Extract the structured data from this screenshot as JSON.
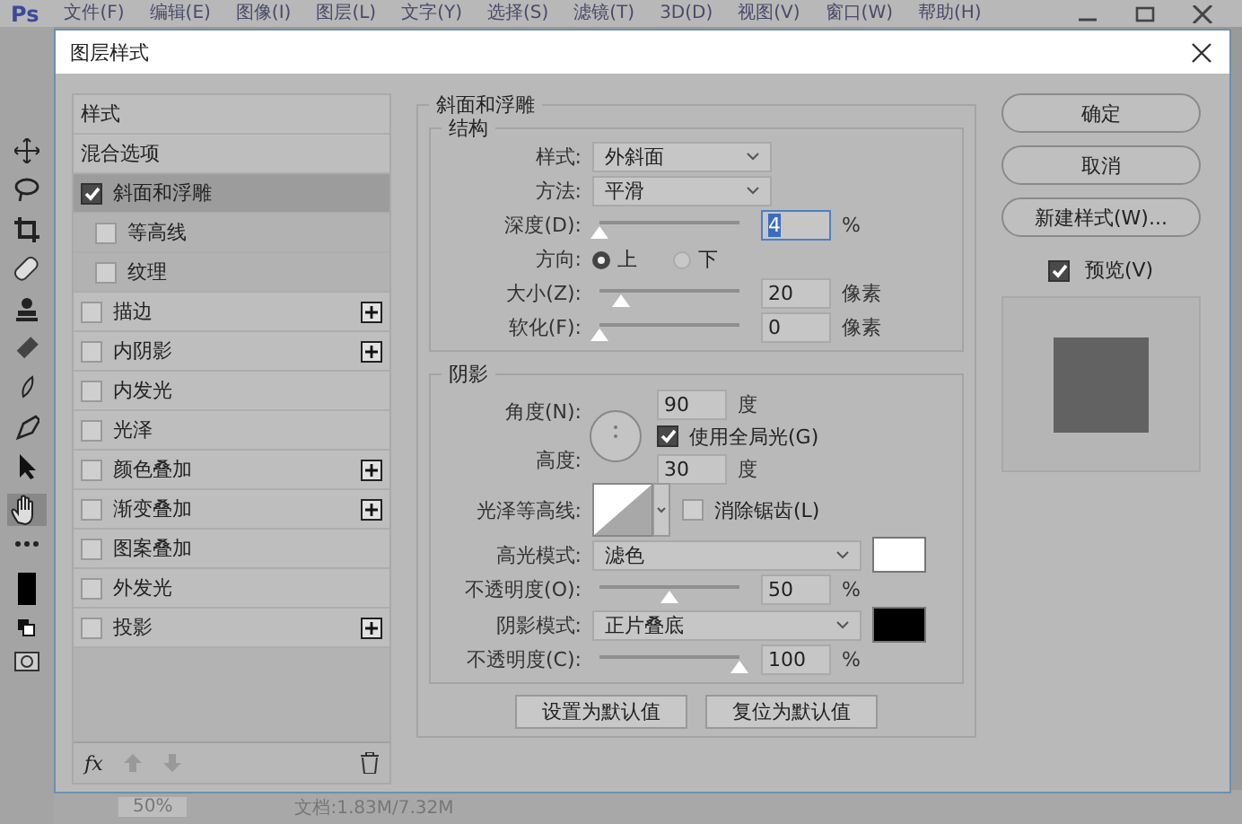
{
  "app": {
    "logo": "Ps",
    "menu": [
      "文件(F)",
      "编辑(E)",
      "图像(I)",
      "图层(L)",
      "文字(Y)",
      "选择(S)",
      "滤镜(T)",
      "3D(D)",
      "视图(V)",
      "窗口(W)",
      "帮助(H)"
    ]
  },
  "status_bar": {
    "zoom": "50%",
    "document": "文档:1.83M/7.32M"
  },
  "dialog": {
    "title": "图层样式",
    "styles_list": [
      {
        "kind": "header",
        "label": "样式",
        "selected": false
      },
      {
        "kind": "header",
        "label": "混合选项",
        "selected": false
      },
      {
        "kind": "effect",
        "label": "斜面和浮雕",
        "checked": true,
        "selected": true,
        "plus": false,
        "children": [
          {
            "label": "等高线",
            "checked": false,
            "selected": false
          },
          {
            "label": "纹理",
            "checked": false,
            "selected": false
          }
        ]
      },
      {
        "kind": "effect",
        "label": "描边",
        "checked": false,
        "selected": false,
        "plus": true
      },
      {
        "kind": "effect",
        "label": "内阴影",
        "checked": false,
        "selected": false,
        "plus": true
      },
      {
        "kind": "effect",
        "label": "内发光",
        "checked": false,
        "selected": false,
        "plus": false
      },
      {
        "kind": "effect",
        "label": "光泽",
        "checked": false,
        "selected": false,
        "plus": false
      },
      {
        "kind": "effect",
        "label": "颜色叠加",
        "checked": false,
        "selected": false,
        "plus": true
      },
      {
        "kind": "effect",
        "label": "渐变叠加",
        "checked": false,
        "selected": false,
        "plus": true
      },
      {
        "kind": "effect",
        "label": "图案叠加",
        "checked": false,
        "selected": false,
        "plus": false
      },
      {
        "kind": "effect",
        "label": "外发光",
        "checked": false,
        "selected": false,
        "plus": false
      },
      {
        "kind": "effect",
        "label": "投影",
        "checked": false,
        "selected": false,
        "plus": true
      }
    ],
    "list_footer": {
      "fx": "fx"
    },
    "bevel": {
      "title": "斜面和浮雕",
      "structure": {
        "title": "结构",
        "rows": [
          {
            "kind": "select",
            "label": "样式:",
            "value": "外斜面"
          },
          {
            "kind": "select",
            "label": "方法:",
            "value": "平滑"
          },
          {
            "kind": "slider",
            "label": "深度(D):",
            "level": 0,
            "value": "4",
            "unit": "%",
            "focused": true
          },
          {
            "kind": "radio",
            "label": "方向:",
            "options": [
              {
                "label": "上",
                "selected": true
              },
              {
                "label": "下",
                "selected": false
              }
            ]
          },
          {
            "kind": "slider",
            "label": "大小(Z):",
            "level": 0.16,
            "value": "20",
            "unit": "像素",
            "focused": false
          },
          {
            "kind": "slider",
            "label": "软化(F):",
            "level": 0,
            "value": "0",
            "unit": "像素",
            "focused": false
          }
        ]
      },
      "shading": {
        "title": "阴影",
        "angle": {
          "label": "角度(N):",
          "value": "90",
          "unit": "度"
        },
        "global_light": {
          "label": "使用全局光(G)",
          "checked": true
        },
        "altitude": {
          "label": "高度:",
          "value": "30",
          "unit": "度"
        },
        "gloss_contour": {
          "label": "光泽等高线:"
        },
        "anti_aliased": {
          "label": "消除锯齿(L)",
          "checked": false
        },
        "rows": [
          {
            "kind": "mode",
            "label": "高光模式:",
            "value": "滤色",
            "color": "#ffffff"
          },
          {
            "kind": "slider",
            "label": "不透明度(O):",
            "level": 0.5,
            "value": "50",
            "unit": "%"
          },
          {
            "kind": "mode",
            "label": "阴影模式:",
            "value": "正片叠底",
            "color": "#000000"
          },
          {
            "kind": "slider",
            "label": "不透明度(C):",
            "level": 1,
            "value": "100",
            "unit": "%"
          }
        ]
      },
      "default_buttons": [
        "设置为默认值",
        "复位为默认值"
      ]
    },
    "buttons": [
      "确定",
      "取消",
      "新建样式(W)..."
    ],
    "preview": {
      "label": "预览(V)",
      "checked": true
    }
  }
}
